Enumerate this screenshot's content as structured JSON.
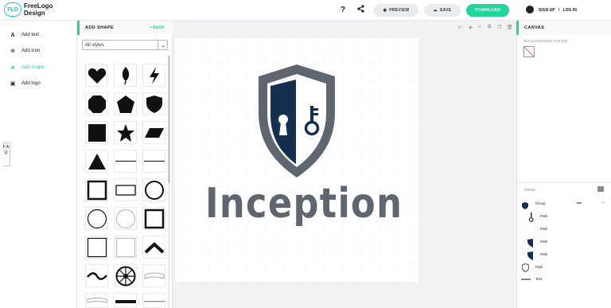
{
  "header": {
    "logo_badge": "FLD",
    "logo_text": "FreeLogo Design",
    "help": "?",
    "preview": "PREVIEW",
    "save": "SAVE",
    "download": "DOWNLOAD",
    "sign_up": "SIGN UP",
    "separator": "/",
    "log_in": "LOG IN"
  },
  "nav": {
    "items": [
      {
        "label": "Add text",
        "icon": "text-icon"
      },
      {
        "label": "Add icon",
        "icon": "globe-icon"
      },
      {
        "label": "Add shape",
        "icon": "star-icon"
      },
      {
        "label": "Add logo",
        "icon": "image-icon"
      }
    ],
    "faq": "F A Q"
  },
  "panel": {
    "title": "ADD SHAPE",
    "back": "< BACK",
    "style_select": "All styles"
  },
  "canvas": {
    "brand_name": "Inception"
  },
  "right": {
    "title": "CANVAS",
    "bg_label": "BACKGROUND COLOR",
    "items_label": "ITEMS",
    "layers": [
      "Group",
      "Path",
      "Path",
      "Path",
      "Path",
      "Path",
      "Text"
    ]
  },
  "colors": {
    "accent": "#21d59b",
    "brand_teal": "#27c7d4",
    "shield_grey": "#5f6670",
    "shield_navy": "#15304f"
  }
}
